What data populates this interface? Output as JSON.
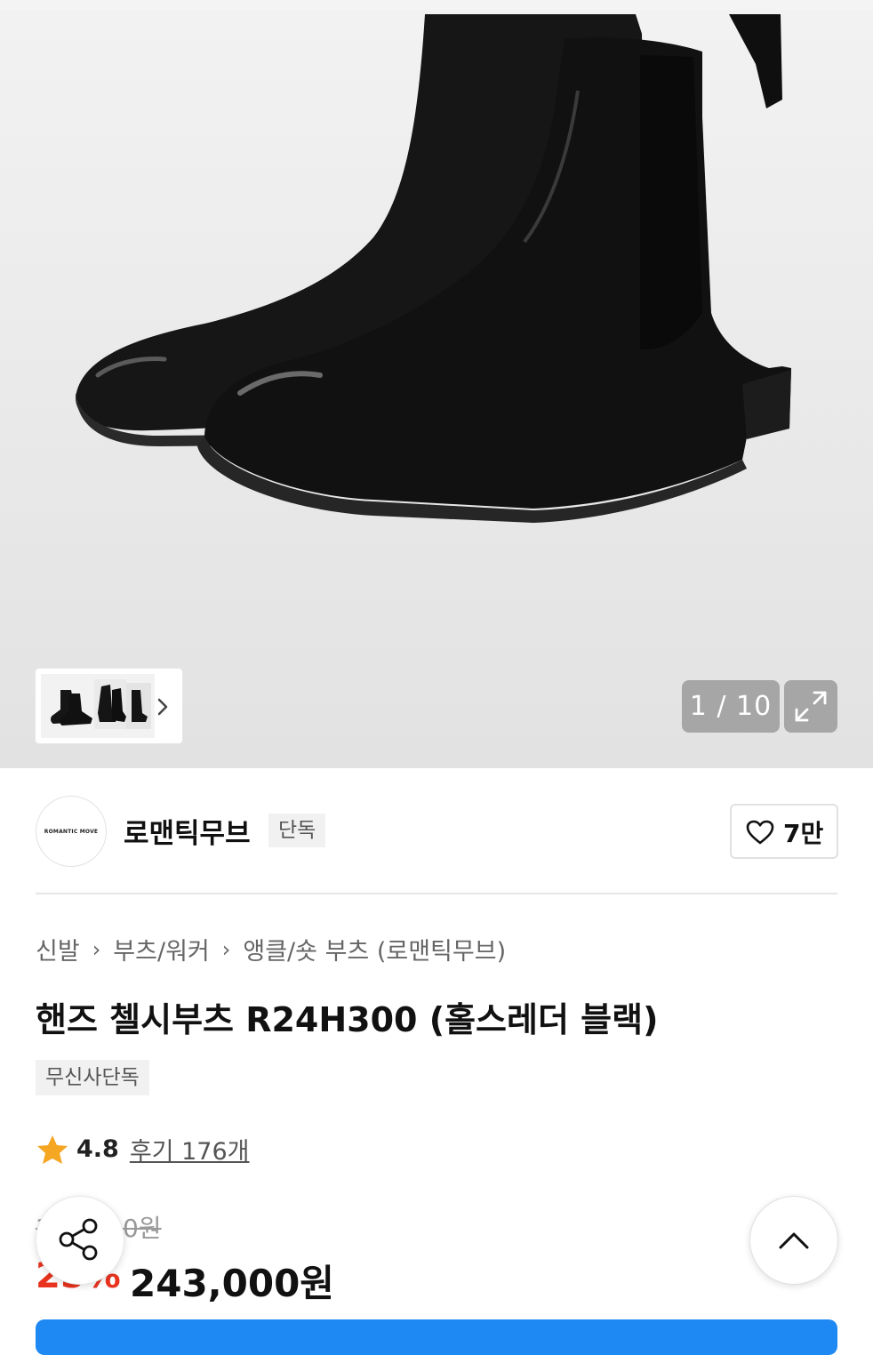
{
  "gallery": {
    "counter": "1 / 10",
    "thumbnail_next_icon": "chevron-right-icon",
    "expand_icon": "expand-arrows-icon"
  },
  "brand": {
    "logo_text": "ROMANTIC MOVE",
    "name": "로맨틱무브",
    "tag": "단독",
    "like_icon": "heart-outline-icon",
    "like_count": "7만"
  },
  "breadcrumb": [
    "신발",
    "부츠/워커",
    "앵클/숏 부츠 (로맨틱무브)"
  ],
  "product": {
    "title": "핸즈 첼시부츠 R24H300 (홀스레더 블랙)",
    "badge": "무신사단독",
    "rating": "4.8",
    "reviews": "후기 176개",
    "original_price": "324,000원",
    "discount": "25%",
    "price": "243,000원"
  },
  "floating": {
    "share_icon": "share-icon",
    "top_icon": "chevron-up-icon"
  },
  "colors": {
    "accent_blue": "#1e88f3",
    "discount_red": "#e8331e",
    "star_orange": "#f5a623"
  }
}
